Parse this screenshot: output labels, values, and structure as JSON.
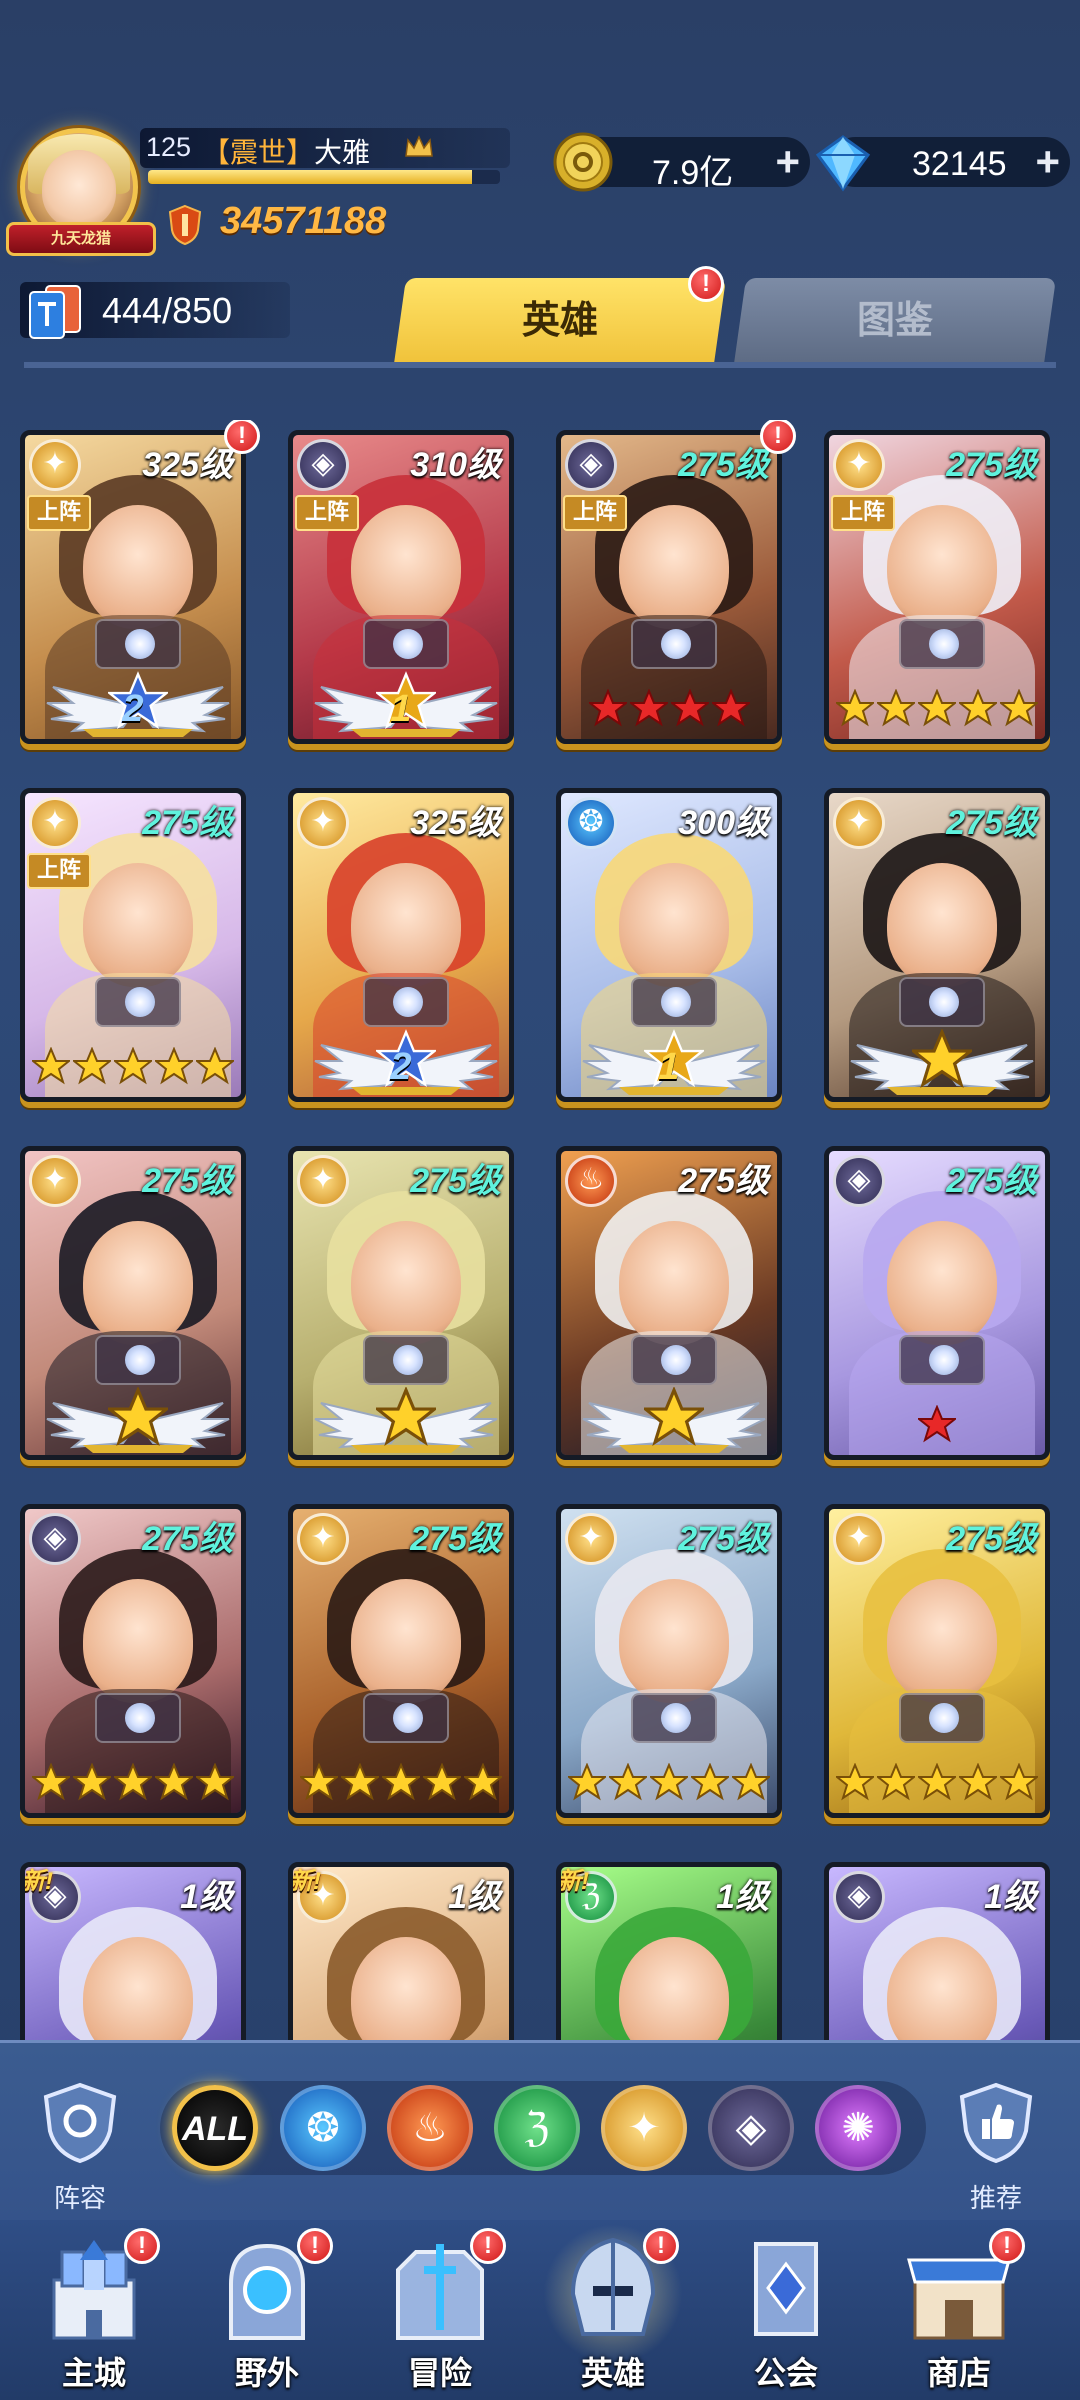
{
  "player": {
    "title_badge": "九天龙猎",
    "level": "125",
    "guild": "【震世】",
    "name": "大雅",
    "xp_fraction": 0.92,
    "power": "34571188"
  },
  "resources": {
    "gold": "7.9亿",
    "gems": "32145",
    "plus": "+"
  },
  "collection": {
    "count": "444/850"
  },
  "tabs": [
    {
      "label": "英雄",
      "active": true
    },
    {
      "label": "图鉴",
      "active": false
    }
  ],
  "badge_mark": "!",
  "deploy_label": "上阵",
  "new_label": "新!",
  "heroes": [
    {
      "faction": "light",
      "level": "325级",
      "level_color": "white",
      "deployed": true,
      "alert": true,
      "grade": "wing",
      "wing_num": "2",
      "wing_color": "blue"
    },
    {
      "faction": "dark",
      "level": "310级",
      "level_color": "white",
      "deployed": true,
      "alert": false,
      "grade": "wing",
      "wing_num": "1",
      "wing_color": "gold"
    },
    {
      "faction": "dark",
      "level": "275级",
      "level_color": "cyan",
      "deployed": true,
      "alert": true,
      "grade": "stars",
      "stars": 4,
      "star_color": "red"
    },
    {
      "faction": "light",
      "level": "275级",
      "level_color": "cyan",
      "deployed": true,
      "alert": false,
      "grade": "stars",
      "stars": 5,
      "star_color": "gold"
    },
    {
      "faction": "light",
      "level": "275级",
      "level_color": "cyan",
      "deployed": true,
      "alert": false,
      "grade": "stars",
      "stars": 5,
      "star_color": "gold"
    },
    {
      "faction": "light",
      "level": "325级",
      "level_color": "white",
      "deployed": false,
      "alert": false,
      "grade": "wing",
      "wing_num": "2",
      "wing_color": "blue"
    },
    {
      "faction": "water",
      "level": "300级",
      "level_color": "white",
      "deployed": false,
      "alert": false,
      "grade": "wing",
      "wing_num": "1",
      "wing_color": "gold"
    },
    {
      "faction": "light",
      "level": "275级",
      "level_color": "cyan",
      "deployed": false,
      "alert": false,
      "grade": "wing_star",
      "star_color": "gold"
    },
    {
      "faction": "light",
      "level": "275级",
      "level_color": "cyan",
      "deployed": false,
      "alert": false,
      "grade": "wing_star",
      "star_color": "gold"
    },
    {
      "faction": "light",
      "level": "275级",
      "level_color": "cyan",
      "deployed": false,
      "alert": false,
      "grade": "wing_star",
      "star_color": "gold"
    },
    {
      "faction": "fire",
      "level": "275级",
      "level_color": "white",
      "deployed": false,
      "alert": false,
      "grade": "wing_star",
      "star_color": "gold"
    },
    {
      "faction": "dark",
      "level": "275级",
      "level_color": "cyan",
      "deployed": false,
      "alert": false,
      "grade": "stars",
      "stars": 1,
      "star_color": "red"
    },
    {
      "faction": "dark",
      "level": "275级",
      "level_color": "cyan",
      "deployed": false,
      "alert": false,
      "grade": "stars",
      "stars": 5,
      "star_color": "gold"
    },
    {
      "faction": "light",
      "level": "275级",
      "level_color": "cyan",
      "deployed": false,
      "alert": false,
      "grade": "stars",
      "stars": 5,
      "star_color": "gold"
    },
    {
      "faction": "light",
      "level": "275级",
      "level_color": "cyan",
      "deployed": false,
      "alert": false,
      "grade": "stars",
      "stars": 5,
      "star_color": "gold"
    },
    {
      "faction": "light",
      "level": "275级",
      "level_color": "cyan",
      "deployed": false,
      "alert": false,
      "grade": "stars",
      "stars": 5,
      "star_color": "gold"
    },
    {
      "faction": "dark",
      "level": "1级",
      "level_color": "white",
      "deployed": false,
      "alert": false,
      "new": true,
      "grade": "none"
    },
    {
      "faction": "light",
      "level": "1级",
      "level_color": "white",
      "deployed": false,
      "alert": false,
      "new": true,
      "grade": "none"
    },
    {
      "faction": "nature",
      "level": "1级",
      "level_color": "white",
      "deployed": false,
      "alert": false,
      "new": true,
      "grade": "none"
    },
    {
      "faction": "dark",
      "level": "1级",
      "level_color": "white",
      "deployed": false,
      "alert": false,
      "new": false,
      "grade": "none"
    }
  ],
  "filter": {
    "lineup_label": "阵容",
    "recommend_label": "推荐",
    "all_label": "ALL",
    "factions": [
      "water",
      "fire",
      "nature",
      "light",
      "dark",
      "chaos"
    ]
  },
  "nav": [
    {
      "label": "主城",
      "icon": "castle-icon",
      "alert": true,
      "active": false
    },
    {
      "label": "野外",
      "icon": "portal-icon",
      "alert": true,
      "active": false
    },
    {
      "label": "冒险",
      "icon": "gate-icon",
      "alert": true,
      "active": false
    },
    {
      "label": "英雄",
      "icon": "helmet-icon",
      "alert": true,
      "active": true
    },
    {
      "label": "公会",
      "icon": "banner-icon",
      "alert": false,
      "active": false
    },
    {
      "label": "商店",
      "icon": "shop-icon",
      "alert": true,
      "active": false
    }
  ],
  "colors": {
    "gold": "#f2c14a",
    "cyan_level": "#5ff2dd",
    "alert_red": "#d01818",
    "tab_active": "#f0c23a"
  }
}
